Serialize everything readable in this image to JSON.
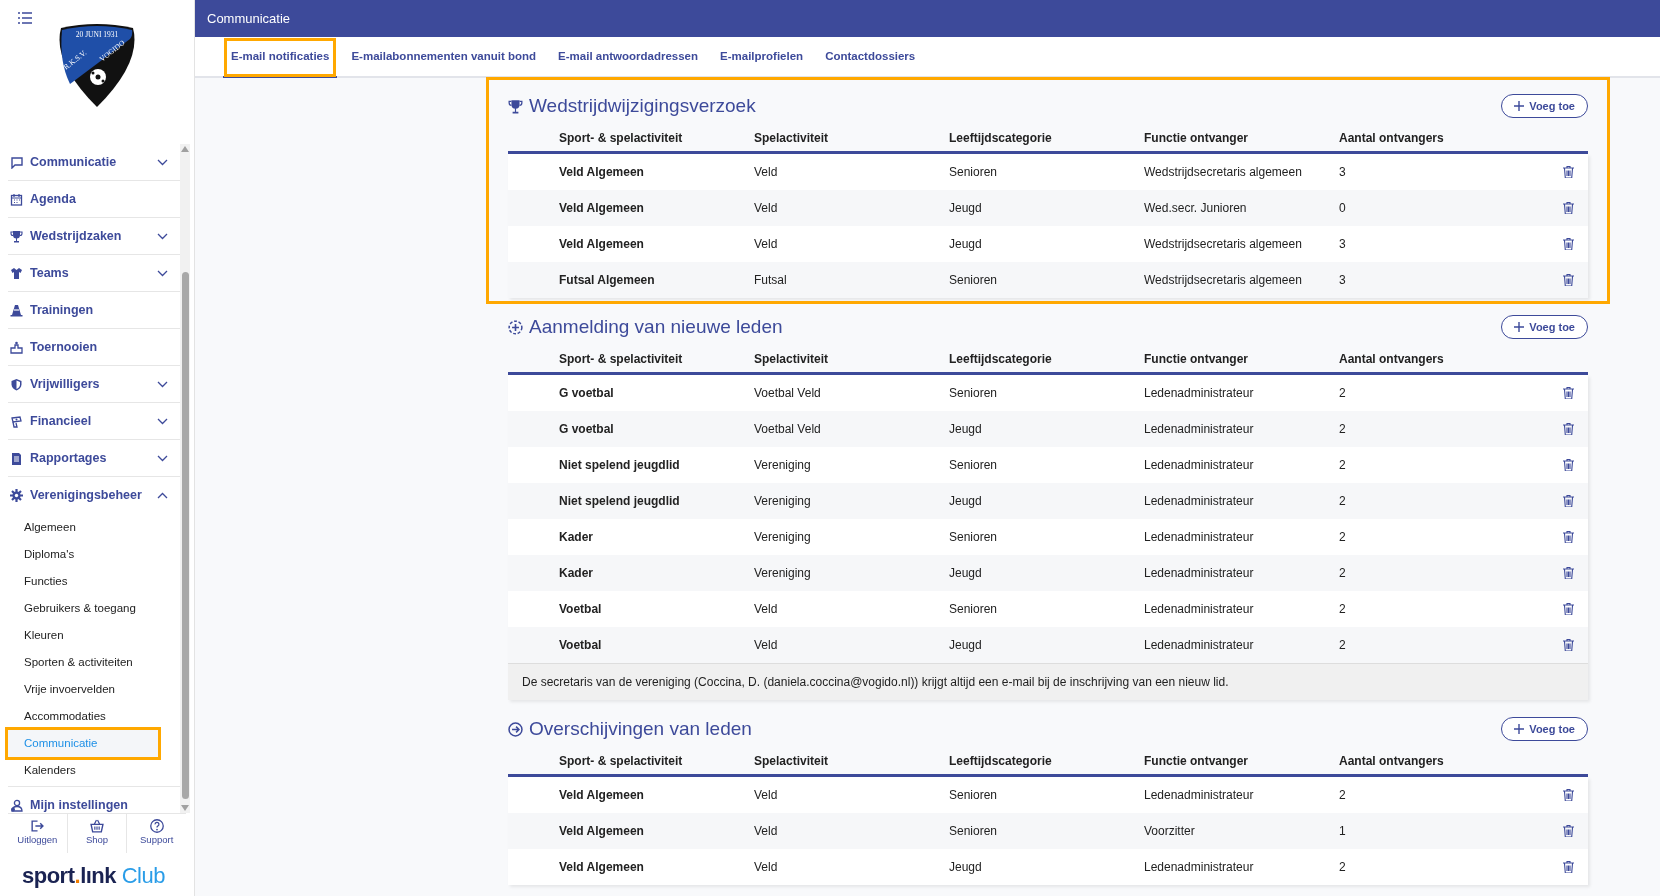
{
  "crest": {
    "top": "20 JUNI 1931",
    "left": "R.K.S.V.",
    "right": "VOGIDO"
  },
  "sidebar": {
    "items": [
      {
        "label": "Communicatie",
        "expanded": false
      },
      {
        "label": "Agenda"
      },
      {
        "label": "Wedstrijdzaken",
        "expanded": false
      },
      {
        "label": "Teams",
        "expanded": false
      },
      {
        "label": "Trainingen"
      },
      {
        "label": "Toernooien"
      },
      {
        "label": "Vrijwilligers",
        "expanded": false
      },
      {
        "label": "Financieel",
        "expanded": false
      },
      {
        "label": "Rapportages",
        "expanded": false
      },
      {
        "label": "Verenigingsbeheer",
        "expanded": true,
        "children": [
          {
            "label": "Algemeen",
            "selected": false,
            "highlighted": false
          },
          {
            "label": "Diploma's",
            "selected": false,
            "highlighted": false
          },
          {
            "label": "Functies",
            "selected": false,
            "highlighted": false
          },
          {
            "label": "Gebruikers & toegang",
            "selected": false,
            "highlighted": false
          },
          {
            "label": "Kleuren",
            "selected": false,
            "highlighted": false
          },
          {
            "label": "Sporten & activiteiten",
            "selected": false,
            "highlighted": false
          },
          {
            "label": "Vrije invoervelden",
            "selected": false,
            "highlighted": false
          },
          {
            "label": "Accommodaties",
            "selected": false,
            "highlighted": false
          },
          {
            "label": "Communicatie",
            "selected": true,
            "highlighted": true
          },
          {
            "label": "Kalenders",
            "selected": false,
            "highlighted": false
          }
        ]
      },
      {
        "label": "Mijn instellingen"
      }
    ],
    "footer_buttons": [
      {
        "label": "Uitloggen"
      },
      {
        "label": "Shop"
      },
      {
        "label": "Support"
      }
    ],
    "brand": [
      {
        "kind": "dark",
        "text": "sport"
      },
      {
        "kind": "dot",
        "text": "."
      },
      {
        "kind": "dark",
        "text": "lınk"
      },
      {
        "kind": "light",
        "text": " Club"
      }
    ]
  },
  "header": {
    "title": "Communicatie"
  },
  "tabs": [
    {
      "label": "E-mail notificaties",
      "selected": true,
      "highlighted": true
    },
    {
      "label": "E-mailabonnementen vanuit bond",
      "selected": false,
      "highlighted": false
    },
    {
      "label": "E-mail antwoordadressen",
      "selected": false,
      "highlighted": false
    },
    {
      "label": "E-mailprofielen",
      "selected": false,
      "highlighted": false
    },
    {
      "label": "Contactdossiers",
      "selected": false,
      "highlighted": false
    }
  ],
  "sections": [
    {
      "title": "Wedstrijdwijzigingsverzoek",
      "highlighted": true,
      "button": "Voeg toe",
      "columns": [
        "Sport- & spelactiviteit",
        "Spelactiviteit",
        "Leeftijdscategorie",
        "Functie ontvanger",
        "Aantal ontvangers"
      ],
      "rows": [
        [
          "Veld Algemeen",
          "Veld",
          "Senioren",
          "Wedstrijdsecretaris algemeen",
          "3"
        ],
        [
          "Veld Algemeen",
          "Veld",
          "Jeugd",
          "Wed.secr. Junioren",
          "0"
        ],
        [
          "Veld Algemeen",
          "Veld",
          "Jeugd",
          "Wedstrijdsecretaris algemeen",
          "3"
        ],
        [
          "Futsal Algemeen",
          "Futsal",
          "Senioren",
          "Wedstrijdsecretaris algemeen",
          "3"
        ]
      ]
    },
    {
      "title": "Aanmelding van nieuwe leden",
      "highlighted": false,
      "button": "Voeg toe",
      "columns": [
        "Sport- & spelactiviteit",
        "Spelactiviteit",
        "Leeftijdscategorie",
        "Functie ontvanger",
        "Aantal ontvangers"
      ],
      "rows": [
        [
          "G voetbal",
          "Voetbal Veld",
          "Senioren",
          "Ledenadministrateur",
          "2"
        ],
        [
          "G voetbal",
          "Voetbal Veld",
          "Jeugd",
          "Ledenadministrateur",
          "2"
        ],
        [
          "Niet spelend jeugdlid",
          "Vereniging",
          "Senioren",
          "Ledenadministrateur",
          "2"
        ],
        [
          "Niet spelend jeugdlid",
          "Vereniging",
          "Jeugd",
          "Ledenadministrateur",
          "2"
        ],
        [
          "Kader",
          "Vereniging",
          "Senioren",
          "Ledenadministrateur",
          "2"
        ],
        [
          "Kader",
          "Vereniging",
          "Jeugd",
          "Ledenadministrateur",
          "2"
        ],
        [
          "Voetbal",
          "Veld",
          "Senioren",
          "Ledenadministrateur",
          "2"
        ],
        [
          "Voetbal",
          "Veld",
          "Jeugd",
          "Ledenadministrateur",
          "2"
        ]
      ],
      "note": "De secretaris van de vereniging (Coccina, D. (daniela.coccina@vogido.nl)) krijgt altijd een e-mail bij de inschrijving van een nieuw lid."
    },
    {
      "title": "Overschijvingen van leden",
      "highlighted": false,
      "button": "Voeg toe",
      "columns": [
        "Sport- & spelactiviteit",
        "Spelactiviteit",
        "Leeftijdscategorie",
        "Functie ontvanger",
        "Aantal ontvangers"
      ],
      "rows": [
        [
          "Veld Algemeen",
          "Veld",
          "Senioren",
          "Ledenadministrateur",
          "2"
        ],
        [
          "Veld Algemeen",
          "Veld",
          "Senioren",
          "Voorzitter",
          "1"
        ],
        [
          "Veld Algemeen",
          "Veld",
          "Jeugd",
          "Ledenadministrateur",
          "2"
        ]
      ]
    }
  ]
}
